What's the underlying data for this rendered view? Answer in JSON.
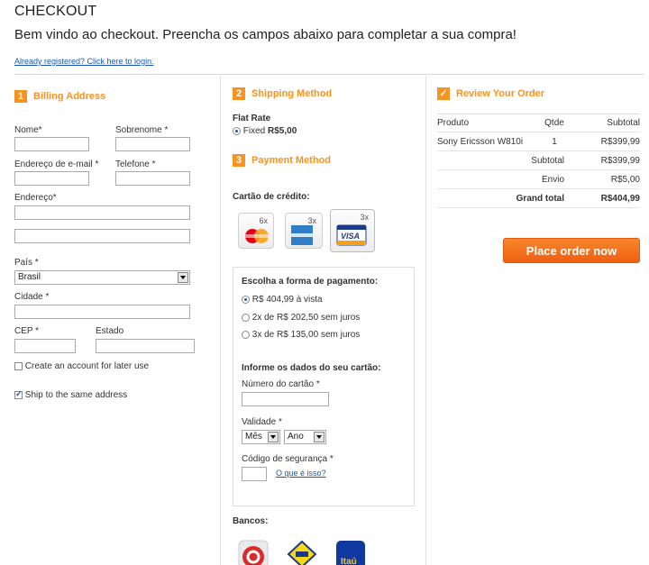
{
  "header": {
    "title": "CHECKOUT",
    "welcome": "Bem vindo ao checkout. Preencha os campos abaixo para completar a sua compra!",
    "login_link": "Already registered? Click here to login."
  },
  "billing": {
    "step": "1",
    "title": "Billing Address",
    "nome_label": "Nome*",
    "sobrenome_label": "Sobrenome *",
    "email_label": "Endereço de e-mail *",
    "telefone_label": "Telefone *",
    "endereco_label": "Endereço*",
    "pais_label": "País *",
    "pais_value": "Brasil",
    "cidade_label": "Cidade *",
    "cep_label": "CEP *",
    "estado_label": "Estado",
    "create_account_label": "Create an account for later use",
    "ship_same_label": "Ship to the same address"
  },
  "shipping": {
    "step": "2",
    "title": "Shipping Method",
    "rate_title": "Flat Rate",
    "fixed_prefix": "Fixed ",
    "fixed_price": "R$5,00"
  },
  "payment": {
    "step": "3",
    "title": "Payment Method",
    "credit_card_label": "Cartão de crédito:",
    "cards": [
      {
        "name": "MasterCard",
        "installments": "6x"
      },
      {
        "name": "American Express",
        "installments": "3x"
      },
      {
        "name": "VISA",
        "installments": "3x"
      }
    ],
    "choose_label": "Escolha a forma de pagamento:",
    "options": [
      "R$ 404,99 à vista",
      "2x de R$ 202,50 sem juros",
      "3x de R$ 135,00 sem juros"
    ],
    "card_data_label": "Informe os dados do seu cartão:",
    "card_number_label": "Número do cartão  *",
    "validity_label": "Validade  *",
    "month_value": "Mês",
    "year_value": "Ano",
    "security_label": "Código de segurança  *",
    "whats_this": "O que é isso?",
    "banks_label": "Bancos:",
    "banks": [
      "Bradesco",
      "Banco do Brasil",
      "Itaú"
    ],
    "itau_text": "Itaú"
  },
  "review": {
    "title": "Review Your Order",
    "columns": [
      "Produto",
      "Qtde",
      "Subtotal"
    ],
    "items": [
      {
        "product": "Sony Ericsson W810i",
        "qty": "1",
        "subtotal": "R$399,99"
      }
    ],
    "subtotal_label": "Subtotal",
    "subtotal_value": "R$399,99",
    "shipping_label": "Envio",
    "shipping_value": "R$5,00",
    "grand_total_label": "Grand total",
    "grand_total_value": "R$404,99",
    "place_order": "Place order now"
  },
  "colors": {
    "accent": "#f7931e",
    "link": "#1a57b4",
    "button": "#f26f1a"
  }
}
